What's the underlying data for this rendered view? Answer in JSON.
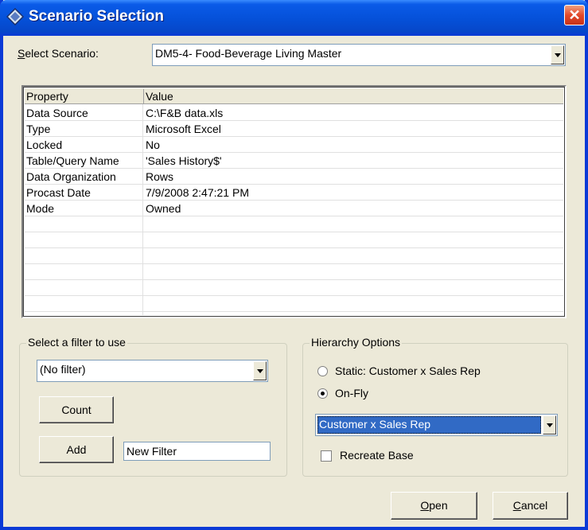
{
  "window": {
    "title": "Scenario Selection",
    "close_glyph": "✕"
  },
  "scenario": {
    "label_prefix": "S",
    "label_rest": "elect Scenario:",
    "value": "DM5-4- Food-Beverage Living Master"
  },
  "grid": {
    "columns": [
      "Property",
      "Value"
    ],
    "rows": [
      [
        "Data Source",
        "C:\\F&B data.xls"
      ],
      [
        "Type",
        "Microsoft Excel"
      ],
      [
        "Locked",
        "No"
      ],
      [
        "Table/Query Name",
        "'Sales History$'"
      ],
      [
        "Data Organization",
        "Rows"
      ],
      [
        "Procast Date",
        "7/9/2008 2:47:21 PM"
      ],
      [
        "Mode",
        "Owned"
      ]
    ]
  },
  "filter": {
    "group_label": "Select a filter to use",
    "selected": "(No filter)",
    "count_label": "Count",
    "add_label": "Add",
    "name_value": "New Filter"
  },
  "hierarchy": {
    "group_label": "Hierarchy Options",
    "static_label": "Static: Customer x Sales Rep",
    "onfly_label": "On-Fly",
    "selected_mode": "On-Fly",
    "combo_value": "Customer x Sales Rep",
    "recreate_label": "Recreate Base",
    "recreate_checked": false
  },
  "footer": {
    "open_prefix": "O",
    "open_rest": "pen",
    "cancel_prefix": "C",
    "cancel_rest": "ancel"
  }
}
